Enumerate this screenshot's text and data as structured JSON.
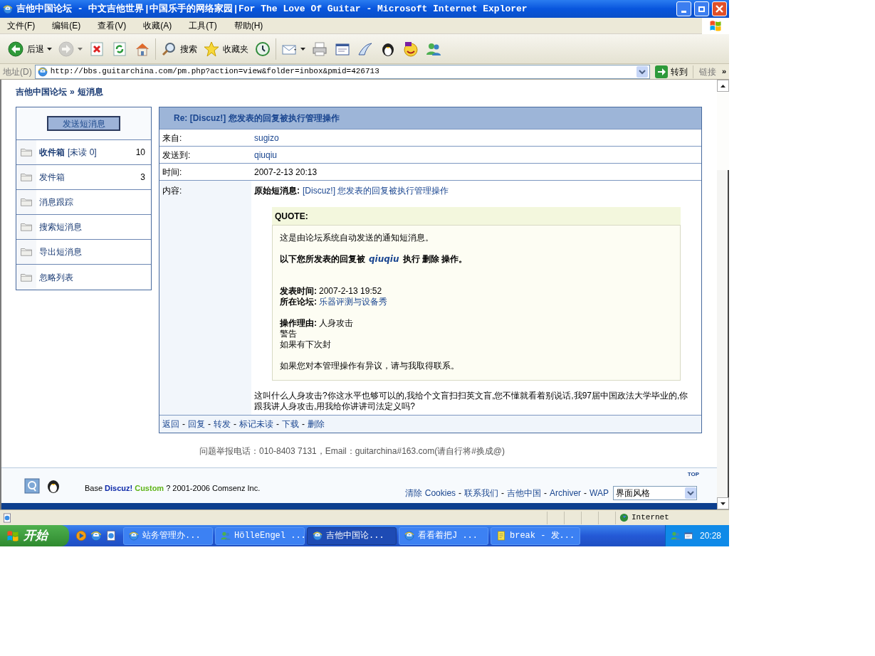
{
  "window": {
    "title": "吉他中国论坛 - 中文吉他世界|中国乐手的网络家园|For The Love Of Guitar - Microsoft Internet Explorer"
  },
  "menu": [
    {
      "label": "文件(F)"
    },
    {
      "label": "编辑(E)"
    },
    {
      "label": "查看(V)"
    },
    {
      "label": "收藏(A)"
    },
    {
      "label": "工具(T)"
    },
    {
      "label": "帮助(H)"
    }
  ],
  "toolbar": [
    {
      "kind": "back",
      "label": "后退",
      "disabled": false
    },
    {
      "kind": "forward",
      "disabled": true
    },
    {
      "kind": "stop",
      "disabled": false
    },
    {
      "kind": "refresh",
      "disabled": false
    },
    {
      "kind": "home",
      "disabled": false
    },
    {
      "kind": "search",
      "label": "搜索",
      "disabled": false
    },
    {
      "kind": "favorites",
      "label": "收藏夹",
      "disabled": false
    },
    {
      "kind": "history",
      "disabled": false
    },
    {
      "kind": "mail",
      "disabled": false
    },
    {
      "kind": "print",
      "disabled": false
    },
    {
      "kind": "edit",
      "disabled": false
    },
    {
      "kind": "messenger",
      "disabled": false
    },
    {
      "kind": "penguin",
      "disabled": false
    },
    {
      "kind": "smiley",
      "disabled": false
    },
    {
      "kind": "people",
      "disabled": false
    }
  ],
  "address_bar": {
    "label": "地址(D)",
    "url": "http://bbs.guitarchina.com/pm.php?action=view&folder=inbox&pmid=426713",
    "go": "转到",
    "links": "链接",
    "more": "»"
  },
  "page": {
    "breadcrumb": {
      "items": [
        "吉他中国论坛",
        "短消息"
      ],
      "separator": "»"
    },
    "sidebar": {
      "send_button": "发送短消息",
      "folders": [
        {
          "label": "收件箱",
          "note": "[未读 0]",
          "count": "10",
          "selected": true
        },
        {
          "label": "发件箱",
          "count": "3",
          "selected": false
        },
        {
          "label": "消息跟踪",
          "selected": false
        },
        {
          "label": "搜索短消息",
          "selected": false
        },
        {
          "label": "导出短消息",
          "selected": false
        },
        {
          "label": "忽略列表",
          "selected": false
        }
      ]
    },
    "message": {
      "title": "Re: [Discuz!] 您发表的回复被执行管理操作",
      "fields": [
        {
          "label": "来自:",
          "value": "sugizo",
          "link": true
        },
        {
          "label": "发送到:",
          "value": "qiuqiu",
          "link": true
        },
        {
          "label": "时间:",
          "value": "2007-2-13 20:13",
          "link": false
        }
      ],
      "content_label": "内容:",
      "original_label": "原始短消息:",
      "original_subject": "[Discuz!] 您发表的回复被执行管理操作",
      "quote": {
        "label": "QUOTE:",
        "blocks": [
          [
            {
              "kind": "plain",
              "text": "这是由论坛系统自动发送的通知短消息。"
            }
          ],
          [
            {
              "kind": "action",
              "before": "以下您所发表的回复被",
              "user": "qiuqiu",
              "after": "执行 删除 操作。"
            }
          ],
          [
            {
              "kind": "field",
              "label": "发表时间:",
              "value": "2007-2-13 19:52",
              "link": false
            },
            {
              "kind": "field",
              "label": "所在论坛:",
              "value": "乐器评测与设备秀",
              "link": true
            }
          ],
          [
            {
              "kind": "field",
              "label": "操作理由:",
              "value": "人身攻击",
              "link": false
            },
            {
              "kind": "plain",
              "text": "警告"
            },
            {
              "kind": "plain",
              "text": "如果有下次封"
            }
          ],
          [
            {
              "kind": "plain",
              "text": "如果您对本管理操作有异议，请与我取得联系。"
            }
          ]
        ]
      },
      "reply": "这叫什么人身攻击?你这水平也够可以的,我给个文盲扫扫英文盲,您不懂就看着别说话,我97届中国政法大学毕业的,你跟我讲人身攻击,用我给你讲讲司法定义吗?",
      "actions": [
        "返回",
        "回复",
        "转发",
        "标记未读",
        "下载",
        "删除"
      ],
      "separator": "-"
    },
    "contact": "问题举报电话：010-8403 7131，Email：guitarchina#163.com(请自行将#换成@)",
    "footer": {
      "top": "TOP",
      "copyright": {
        "base": "Base",
        "brand": "Discuz!",
        "edition": "Custom",
        "rest": "? 2001-2006 Comsenz Inc."
      },
      "links": [
        "清除 Cookies",
        "联系我们",
        "吉他中国",
        "Archiver",
        "WAP"
      ],
      "separator": "-",
      "style_select": "界面风格"
    }
  },
  "status_bar": {
    "zone": "Internet"
  },
  "taskbar": {
    "start": "开始",
    "quick_launch": [
      {
        "kind": "media"
      },
      {
        "kind": "ie"
      },
      {
        "kind": "ie-doc"
      }
    ],
    "tasks": [
      {
        "kind": "ie",
        "label": "站务管理办...",
        "selected": false
      },
      {
        "kind": "people",
        "label": "HölleEngel ...",
        "selected": false
      },
      {
        "kind": "ie",
        "label": "吉他中国论...",
        "selected": true
      },
      {
        "kind": "ie",
        "label": "看看着把J ...",
        "selected": false
      },
      {
        "kind": "note",
        "label": "break - 发...",
        "selected": false
      }
    ],
    "clock": "20:28"
  }
}
